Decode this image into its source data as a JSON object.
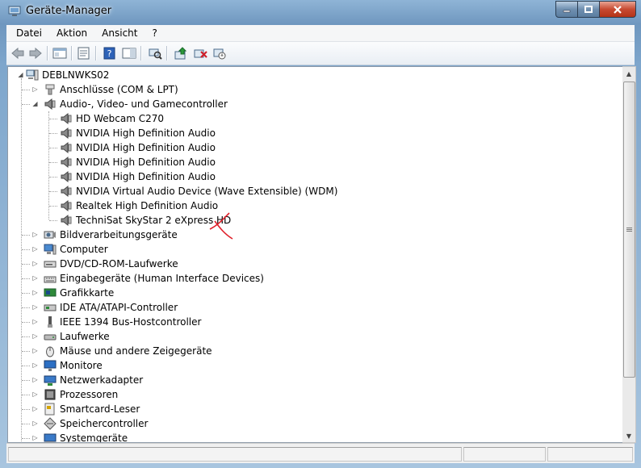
{
  "window": {
    "title": "Geräte-Manager"
  },
  "menu": [
    "Datei",
    "Aktion",
    "Ansicht",
    "?"
  ],
  "tree": {
    "root": "DEBLNWKS02",
    "items": [
      {
        "label": "Anschlüsse (COM & LPT)",
        "icon": "port-icon",
        "expanded": false
      },
      {
        "label": "Audio-, Video- und Gamecontroller",
        "icon": "speaker-icon",
        "expanded": true,
        "children": [
          "HD Webcam C270",
          "NVIDIA High Definition Audio",
          "NVIDIA High Definition Audio",
          "NVIDIA High Definition Audio",
          "NVIDIA High Definition Audio",
          "NVIDIA Virtual Audio Device (Wave Extensible) (WDM)",
          "Realtek High Definition Audio",
          "TechniSat SkyStar 2 eXpress HD"
        ]
      },
      {
        "label": "Bildverarbeitungsgeräte",
        "icon": "camera-icon",
        "expanded": false
      },
      {
        "label": "Computer",
        "icon": "computer-icon",
        "expanded": false
      },
      {
        "label": "DVD/CD-ROM-Laufwerke",
        "icon": "disc-drive-icon",
        "expanded": false
      },
      {
        "label": "Eingabegeräte (Human Interface Devices)",
        "icon": "hid-icon",
        "expanded": false
      },
      {
        "label": "Grafikkarte",
        "icon": "display-adapter-icon",
        "expanded": false
      },
      {
        "label": "IDE ATA/ATAPI-Controller",
        "icon": "ide-controller-icon",
        "expanded": false
      },
      {
        "label": "IEEE 1394 Bus-Hostcontroller",
        "icon": "firewire-icon",
        "expanded": false
      },
      {
        "label": "Laufwerke",
        "icon": "disk-drive-icon",
        "expanded": false
      },
      {
        "label": "Mäuse und andere Zeigegeräte",
        "icon": "mouse-icon",
        "expanded": false
      },
      {
        "label": "Monitore",
        "icon": "monitor-icon",
        "expanded": false
      },
      {
        "label": "Netzwerkadapter",
        "icon": "network-adapter-icon",
        "expanded": false
      },
      {
        "label": "Prozessoren",
        "icon": "processor-icon",
        "expanded": false
      },
      {
        "label": "Smartcard-Leser",
        "icon": "smartcard-icon",
        "expanded": false
      },
      {
        "label": "Speichercontroller",
        "icon": "storage-controller-icon",
        "expanded": false
      },
      {
        "label": "Systemgeräte",
        "icon": "system-device-icon",
        "expanded": false
      }
    ]
  },
  "colors": {
    "annotation": "#e0202a",
    "selection_frame": "#8e9aa8"
  }
}
